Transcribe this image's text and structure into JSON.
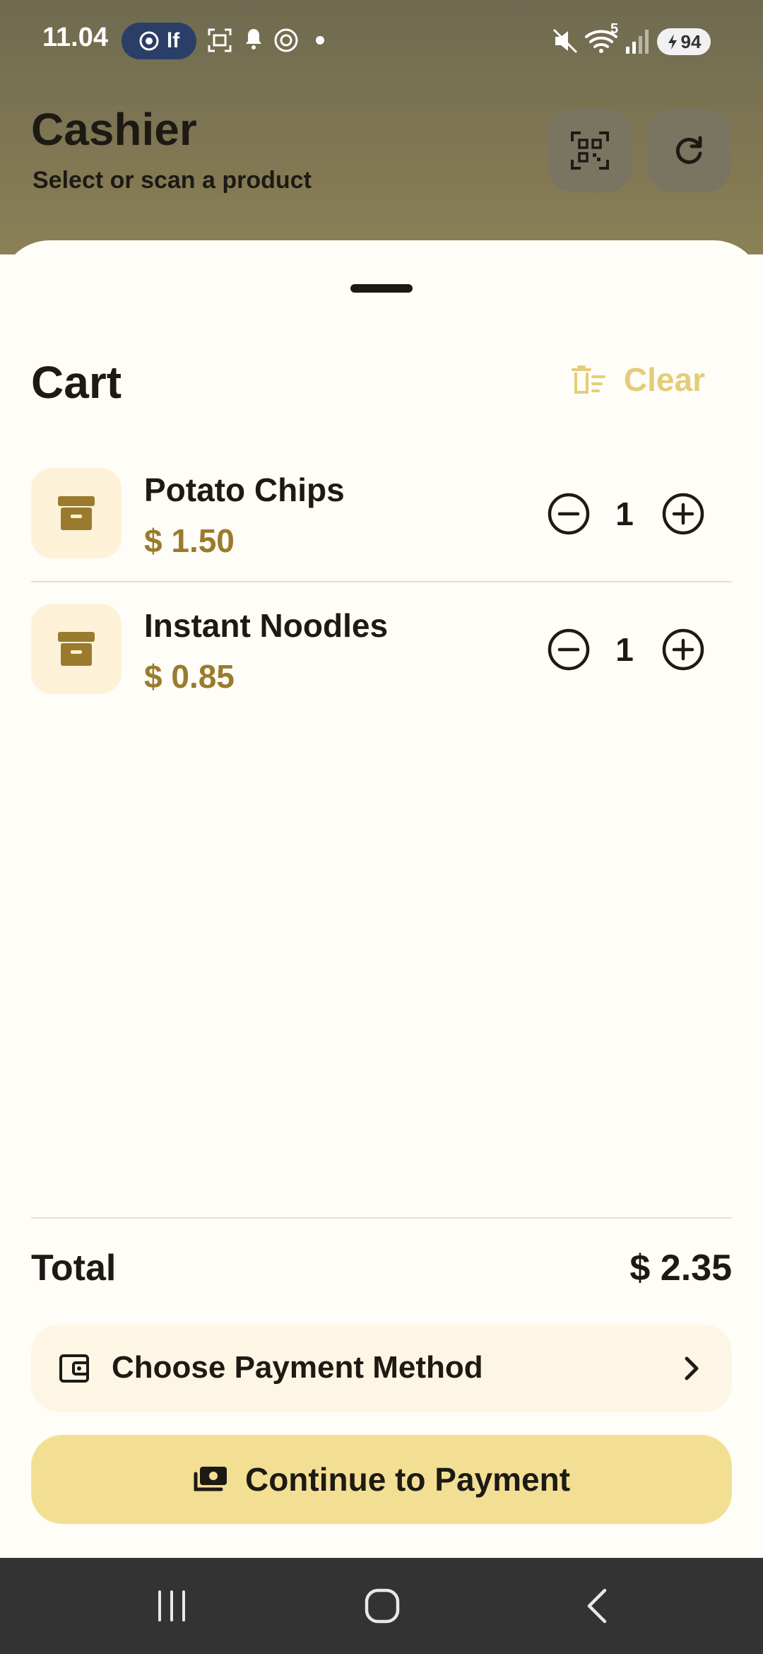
{
  "status_bar": {
    "time": "11.04",
    "pill_label": "lf",
    "wifi_badge": "5",
    "battery": "94"
  },
  "header": {
    "title": "Cashier",
    "subtitle": "Select or scan a product"
  },
  "cart": {
    "title": "Cart",
    "clear_label": "Clear",
    "items": [
      {
        "name": "Potato Chips",
        "price": "$ 1.50",
        "qty": "1"
      },
      {
        "name": "Instant Noodles",
        "price": "$ 0.85",
        "qty": "1"
      }
    ]
  },
  "summary": {
    "total_label": "Total",
    "total_value": "$ 2.35"
  },
  "actions": {
    "payment_method_label": "Choose Payment Method",
    "continue_label": "Continue to Payment"
  },
  "colors": {
    "accent": "#9a7b2e",
    "clear": "#e4cd79",
    "continue_bg": "#f3df94"
  }
}
